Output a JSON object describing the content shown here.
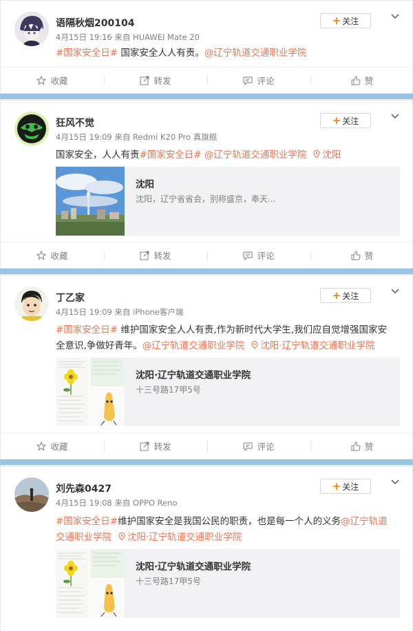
{
  "common": {
    "follow": "关注",
    "actions": {
      "favorite": "收藏",
      "repost": "转发",
      "comment": "评论",
      "like": "赞"
    }
  },
  "colors": {
    "accent": "#eb7350",
    "follow_plus": "#ff8200",
    "stripe": "#9ac5e2",
    "meta": "#808080"
  },
  "posts": [
    {
      "user": "语隔秋烟200104",
      "meta": "4月15日 19:16 来自 HUAWEI Mate 20",
      "line1": {
        "tag": "#国家安全日#",
        "text": " 国家安全人人有责。",
        "at": "@辽宁轨道交通职业学院"
      }
    },
    {
      "user": "狂风不觉",
      "meta": "4月15日 19:09 来自 Redmi K20 Pro 真旗舰",
      "line1": {
        "text": "国家安全，人人有责",
        "tag": "#国家安全日#",
        "at": " @辽宁轨道交通职业学院",
        "loc": "沈阳"
      },
      "media": {
        "title": "沈阳",
        "sub": "沈阳，辽宁省省会，别称盛京，奉天..."
      }
    },
    {
      "user": "丁乙家",
      "meta": "4月15日 19:09 来自 iPhone客户端",
      "line1": {
        "tag": "#国家安全日#",
        "text": " 维护国家安全人人有责,作为新时代大学生,我们应自觉增强国家安"
      },
      "line2": {
        "text": "全意识,争做好青年。",
        "at": "@辽宁轨道交通职业学院",
        "loc": "沈阳·辽宁轨道交通职业学院"
      },
      "media": {
        "title": "沈阳·辽宁轨道交通职业学院",
        "sub": "十三号路17甲5号"
      }
    },
    {
      "user": "刘先森0427",
      "meta": "4月15日 19:08 来自 OPPO Reno",
      "line1": {
        "tag": "#国家安全日#",
        "text": "维护国家安全是我国公民的职责，也是每一个人的义务",
        "at": "@辽宁轨道"
      },
      "line2": {
        "at": "交通职业学院",
        "loc": "沈阳·辽宁轨道交通职业学院"
      },
      "media": {
        "title": "沈阳·辽宁轨道交通职业学院",
        "sub": "十三号路17甲5号"
      }
    }
  ]
}
